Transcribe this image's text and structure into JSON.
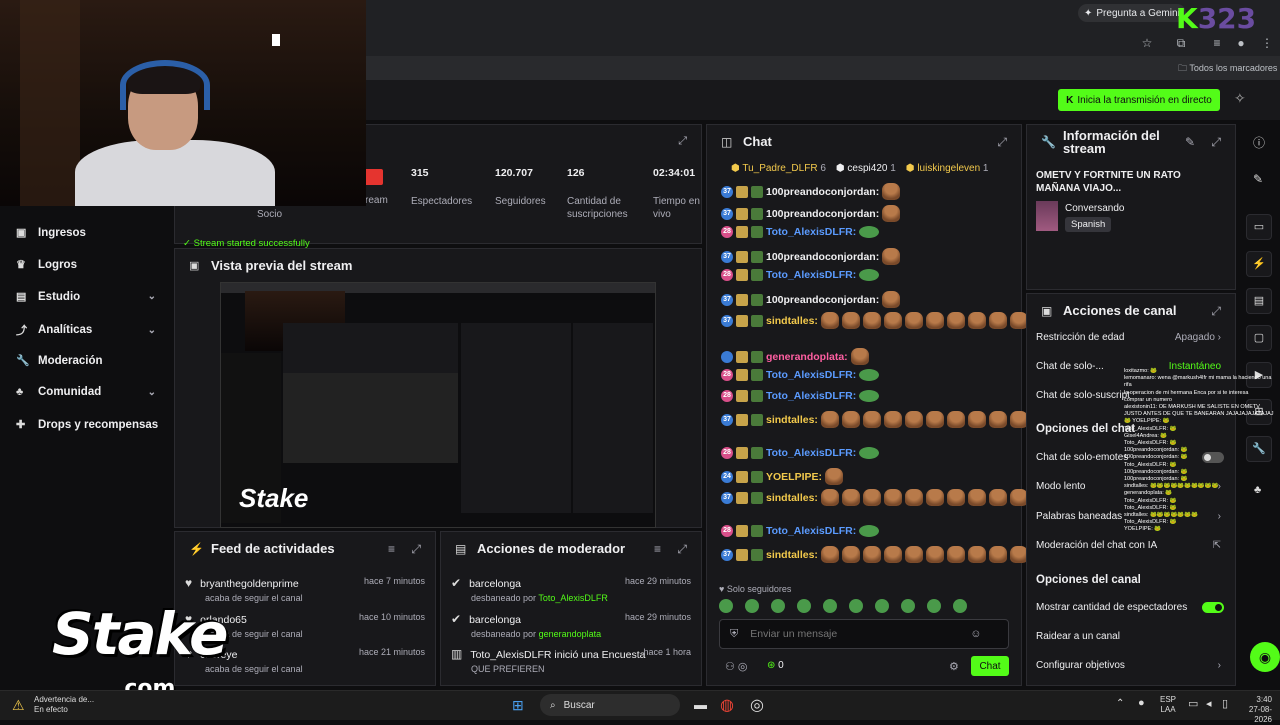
{
  "browser": {
    "gemini_label": "Pregunta a Gemini",
    "bookmarks_all": "Todos los marcadores",
    "kick_badge_k": "K",
    "kick_badge_num": "323"
  },
  "header": {
    "live_button": "Inicia la transmisión en directo"
  },
  "nav": {
    "items": [
      {
        "label": "Ingresos",
        "icon": "wallet-icon"
      },
      {
        "label": "Logros",
        "icon": "trophy-icon"
      },
      {
        "label": "Estudio",
        "icon": "studio-icon"
      },
      {
        "label": "Analíticas",
        "icon": "analytics-icon"
      },
      {
        "label": "Moderación",
        "icon": "wrench-icon"
      },
      {
        "label": "Comunidad",
        "icon": "community-icon"
      },
      {
        "label": "Drops y recompensas",
        "icon": "gift-icon"
      }
    ]
  },
  "stats": {
    "partner_label": "Socio",
    "stream_label": "ream",
    "viewers_value": "315",
    "viewers_label": "Espectadores",
    "followers_value": "120.707",
    "followers_label": "Seguidores",
    "subs_value": "126",
    "subs_label": "Cantidad de suscripciones",
    "time_value": "02:34:01",
    "time_label": "Tiempo en vivo",
    "status": "Stream started successfully"
  },
  "preview": {
    "title": "Vista previa del stream"
  },
  "feed": {
    "title": "Feed de actividades",
    "items": [
      {
        "user": "bryanthegoldenprime",
        "action": "acaba de seguir el canal",
        "time": "hace 7 minutos"
      },
      {
        "user": "orlando65",
        "action": "acaba de seguir el canal",
        "time": "hace 10 minutos"
      },
      {
        "user": "choreye",
        "action": "acaba de seguir el canal",
        "time": "hace 21 minutos"
      }
    ]
  },
  "modactions": {
    "title": "Acciones de moderador",
    "items": [
      {
        "user": "barcelonga",
        "action": "desbaneado por",
        "by": "Toto_AlexisDLFR",
        "time": "hace 29 minutos"
      },
      {
        "user": "barcelonga",
        "action": "desbaneado por",
        "by": "generandoplata",
        "time": "hace 29 minutos"
      },
      {
        "user": "Toto_AlexisDLFR",
        "action": "inició una Encuesta",
        "by": "QUE PREFIEREN",
        "time": "hace 1 hora"
      }
    ]
  },
  "chat": {
    "title": "Chat",
    "top_gifters": [
      {
        "name": "Tu_Padre_DLFR",
        "count": "6"
      },
      {
        "name": "cespi420",
        "count": "1"
      },
      {
        "name": "luiskingeleven",
        "count": "1"
      }
    ],
    "messages": [
      {
        "badge": "37",
        "name": "100preandoconjordan:",
        "color": "white"
      },
      {
        "badge": "37",
        "name": "100preandoconjordan:",
        "color": "white"
      },
      {
        "badge": "28",
        "name": "Toto_AlexisDLFR:",
        "color": "blue"
      },
      {
        "badge": "37",
        "name": "100preandoconjordan:",
        "color": "white"
      },
      {
        "badge": "28",
        "name": "Toto_AlexisDLFR:",
        "color": "blue"
      },
      {
        "badge": "37",
        "name": "100preandoconjordan:",
        "color": "white"
      },
      {
        "badge": "37",
        "name": "sindtalles:",
        "color": "yellow"
      },
      {
        "badge": "",
        "name": "generandoplata:",
        "color": "pink"
      },
      {
        "badge": "28",
        "name": "Toto_AlexisDLFR:",
        "color": "blue"
      },
      {
        "badge": "28",
        "name": "Toto_AlexisDLFR:",
        "color": "blue"
      },
      {
        "badge": "37",
        "name": "sindtalles:",
        "color": "yellow"
      },
      {
        "badge": "28",
        "name": "Toto_AlexisDLFR:",
        "color": "blue"
      },
      {
        "badge": "24",
        "name": "YOELPIPE:",
        "color": "yellow"
      },
      {
        "badge": "37",
        "name": "sindtalles:",
        "color": "yellow"
      },
      {
        "badge": "28",
        "name": "Toto_AlexisDLFR:",
        "color": "blue"
      },
      {
        "badge": "37",
        "name": "sindtalles:",
        "color": "yellow"
      }
    ],
    "followers_only": "Solo seguidores",
    "placeholder": "Enviar un mensaje",
    "points": "0",
    "send_label": "Chat"
  },
  "info": {
    "title": "Información del stream",
    "stream_title": "OMETV Y FORTNITE UN RATO MAÑANA VIAJO...",
    "category": "Conversando",
    "language": "Spanish"
  },
  "canal": {
    "title": "Acciones de canal",
    "age_label": "Restricción de edad",
    "age_value": "Apagado",
    "chat_solo_label": "Chat de solo-...",
    "chat_solo_value": "Instantáneo",
    "chat_subs_label": "Chat de solo-suscript",
    "chat_options": "Opciones del chat",
    "emotes_label": "Chat de solo-emotes",
    "slow_label": "Modo lento",
    "banned_label": "Palabras baneadas",
    "automod_label": "Moderación del chat con IA",
    "channel_options": "Opciones del canal",
    "show_viewers_label": "Mostrar cantidad de espectadores",
    "raid_label": "Raidear a un canal",
    "goals_label": "Configurar objetivos"
  },
  "overlay": {
    "lines": [
      "loxitazmo: 🐸",
      "lemomanaro: wena @markush4Ifr mi mama la haciendo una rifa",
      "la operacion de mi hermana Enca por si te interesa",
      "comprar un numero",
      "alexistonin11: OE MARKUSH ME SALISTE EN OMETV",
      "JUSTO ANTES DE QUE TE BANEARAN JAJAJAJAJAJAJAJ",
      "🐸 YOELPIPE: 🐸",
      "Toto_AlexisDLFR: 🐸",
      "Gisel4Andrea: 🐸",
      "Toto_AlexisDLFR: 🐸",
      "100preandoconjordan: 🐸",
      "100preandoconjordan: 🐸",
      "Toto_AlexisDLFR: 🐸",
      "100preandoconjordan: 🐸",
      "100preandoconjordan: 🐸",
      "sindtalles: 🐸🐸🐸🐸🐸🐸🐸🐸🐸🐸",
      "generandoplata: 🐸",
      "Toto_AlexisDLFR: 🐸",
      "Toto_AlexisDLFR: 🐸",
      "sindtalles: 🐸🐸🐸🐸🐸🐸🐸",
      "Toto_AlexisDLFR: 🐸",
      "YOELPIPE: 🐸"
    ]
  },
  "stake": {
    "brand": "Stake",
    "com": ".com"
  },
  "taskbar": {
    "warning": "Advertencia de...",
    "warning_sub": "En efecto",
    "search": "Buscar",
    "lang": "ESP",
    "lang_sub": "LAA",
    "time": "3:40",
    "date": "27-08-2026"
  },
  "colors": {
    "accent": "#53fc18",
    "panel": "#18181b",
    "bg": "#0e0e10"
  }
}
